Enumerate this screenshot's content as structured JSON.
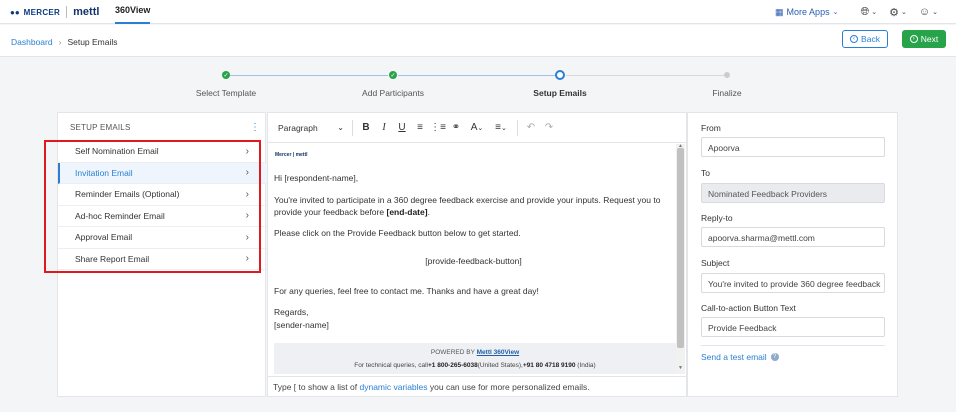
{
  "header": {
    "brand_mercer": "MERCER",
    "brand_mettl": "mettl",
    "app_tab": "360View",
    "more_apps": "More Apps"
  },
  "breadcrumb": {
    "dashboard": "Dashboard",
    "current": "Setup Emails"
  },
  "actions": {
    "back": "Back",
    "next": "Next"
  },
  "stepper": {
    "steps": [
      {
        "label": "Select Template",
        "state": "done"
      },
      {
        "label": "Add Participants",
        "state": "done"
      },
      {
        "label": "Setup Emails",
        "state": "active"
      },
      {
        "label": "Finalize",
        "state": "pending"
      }
    ]
  },
  "sidebar": {
    "title": "SETUP EMAILS",
    "items": [
      {
        "label": "Self Nomination Email"
      },
      {
        "label": "Invitation Email",
        "active": true
      },
      {
        "label": "Reminder Emails (Optional)"
      },
      {
        "label": "Ad-hoc Reminder Email"
      },
      {
        "label": "Approval Email"
      },
      {
        "label": "Share Report Email"
      }
    ]
  },
  "editor": {
    "paragraph_select": "Paragraph",
    "mini_logo": "Mercer | mettl",
    "greeting": "Hi [respondent-name],",
    "body_1": "You're invited to participate in a 360 degree feedback exercise and provide your inputs. Request you to provide your feedback before",
    "body_1_bold": "[end-date]",
    "body_2": "Please click on the Provide Feedback button below to get started.",
    "cta_placeholder": "[provide-feedback-button]",
    "body_3": "For any queries, feel free to contact me. Thanks and have a great day!",
    "regards": "Regards,",
    "sender": "[sender-name]",
    "footer_powered": "POWERED BY",
    "footer_link": "Mettl 360View",
    "footer_contact_prefix": "For technical queries, call",
    "footer_us_phone": "+1 800-265-6038",
    "footer_us_label": "(United States),",
    "footer_in_phone": "+91 80 4718 9190",
    "footer_in_label": " (India)",
    "hint_prefix": "Type [ to show a list of",
    "hint_link": "dynamic variables",
    "hint_suffix": "you can use for more personalized emails."
  },
  "form": {
    "from_label": "From",
    "from_value": "Apoorva",
    "to_label": "To",
    "to_value": "Nominated Feedback Providers",
    "reply_label": "Reply-to",
    "reply_value": "apoorva.sharma@mettl.com",
    "subject_label": "Subject",
    "subject_value": "You're invited to provide 360 degree feedback",
    "cta_label": "Call-to-action Button Text",
    "cta_value": "Provide Feedback",
    "test_email": "Send a test email"
  },
  "colors": {
    "accent": "#2a7fd4",
    "success": "#27a34a",
    "highlight": "#e0191e"
  }
}
